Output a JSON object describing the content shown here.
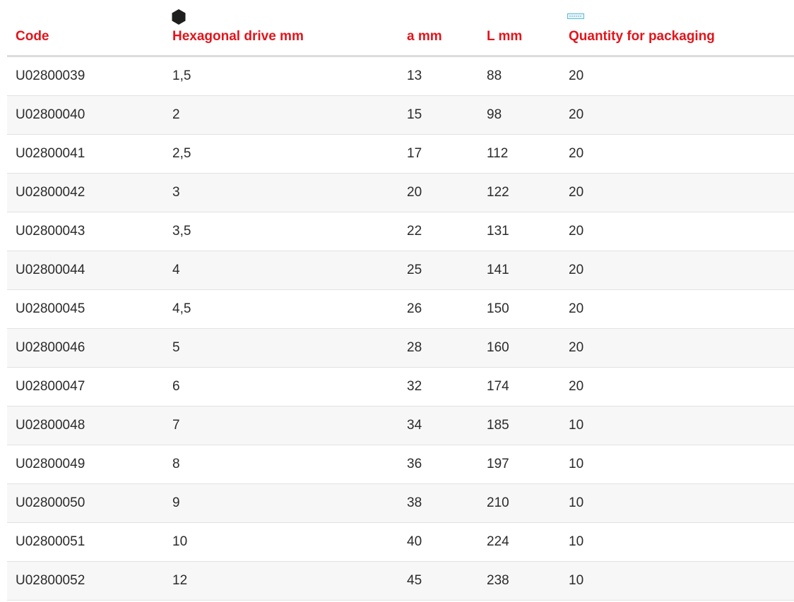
{
  "table": {
    "headers": {
      "code": "Code",
      "hex_drive": "Hexagonal drive mm",
      "a": "a mm",
      "l": "L mm",
      "qty": "Quantity for packaging"
    },
    "icons": {
      "hex_drive": "hexagon-icon",
      "qty": "package-icon"
    },
    "rows": [
      {
        "code": "U02800039",
        "hex": "1,5",
        "a": "13",
        "l": "88",
        "qty": "20"
      },
      {
        "code": "U02800040",
        "hex": "2",
        "a": "15",
        "l": "98",
        "qty": "20"
      },
      {
        "code": "U02800041",
        "hex": "2,5",
        "a": "17",
        "l": "112",
        "qty": "20"
      },
      {
        "code": "U02800042",
        "hex": "3",
        "a": "20",
        "l": "122",
        "qty": "20"
      },
      {
        "code": "U02800043",
        "hex": "3,5",
        "a": "22",
        "l": "131",
        "qty": "20"
      },
      {
        "code": "U02800044",
        "hex": "4",
        "a": "25",
        "l": "141",
        "qty": "20"
      },
      {
        "code": "U02800045",
        "hex": "4,5",
        "a": "26",
        "l": "150",
        "qty": "20"
      },
      {
        "code": "U02800046",
        "hex": "5",
        "a": "28",
        "l": "160",
        "qty": "20"
      },
      {
        "code": "U02800047",
        "hex": "6",
        "a": "32",
        "l": "174",
        "qty": "20"
      },
      {
        "code": "U02800048",
        "hex": "7",
        "a": "34",
        "l": "185",
        "qty": "10"
      },
      {
        "code": "U02800049",
        "hex": "8",
        "a": "36",
        "l": "197",
        "qty": "10"
      },
      {
        "code": "U02800050",
        "hex": "9",
        "a": "38",
        "l": "210",
        "qty": "10"
      },
      {
        "code": "U02800051",
        "hex": "10",
        "a": "40",
        "l": "224",
        "qty": "10"
      },
      {
        "code": "U02800052",
        "hex": "12",
        "a": "45",
        "l": "238",
        "qty": "10"
      }
    ]
  },
  "colors": {
    "header_text": "#e3141b",
    "body_text": "#2b2b2b",
    "row_alt": "#f7f7f7",
    "divider": "#e2e2e2"
  }
}
